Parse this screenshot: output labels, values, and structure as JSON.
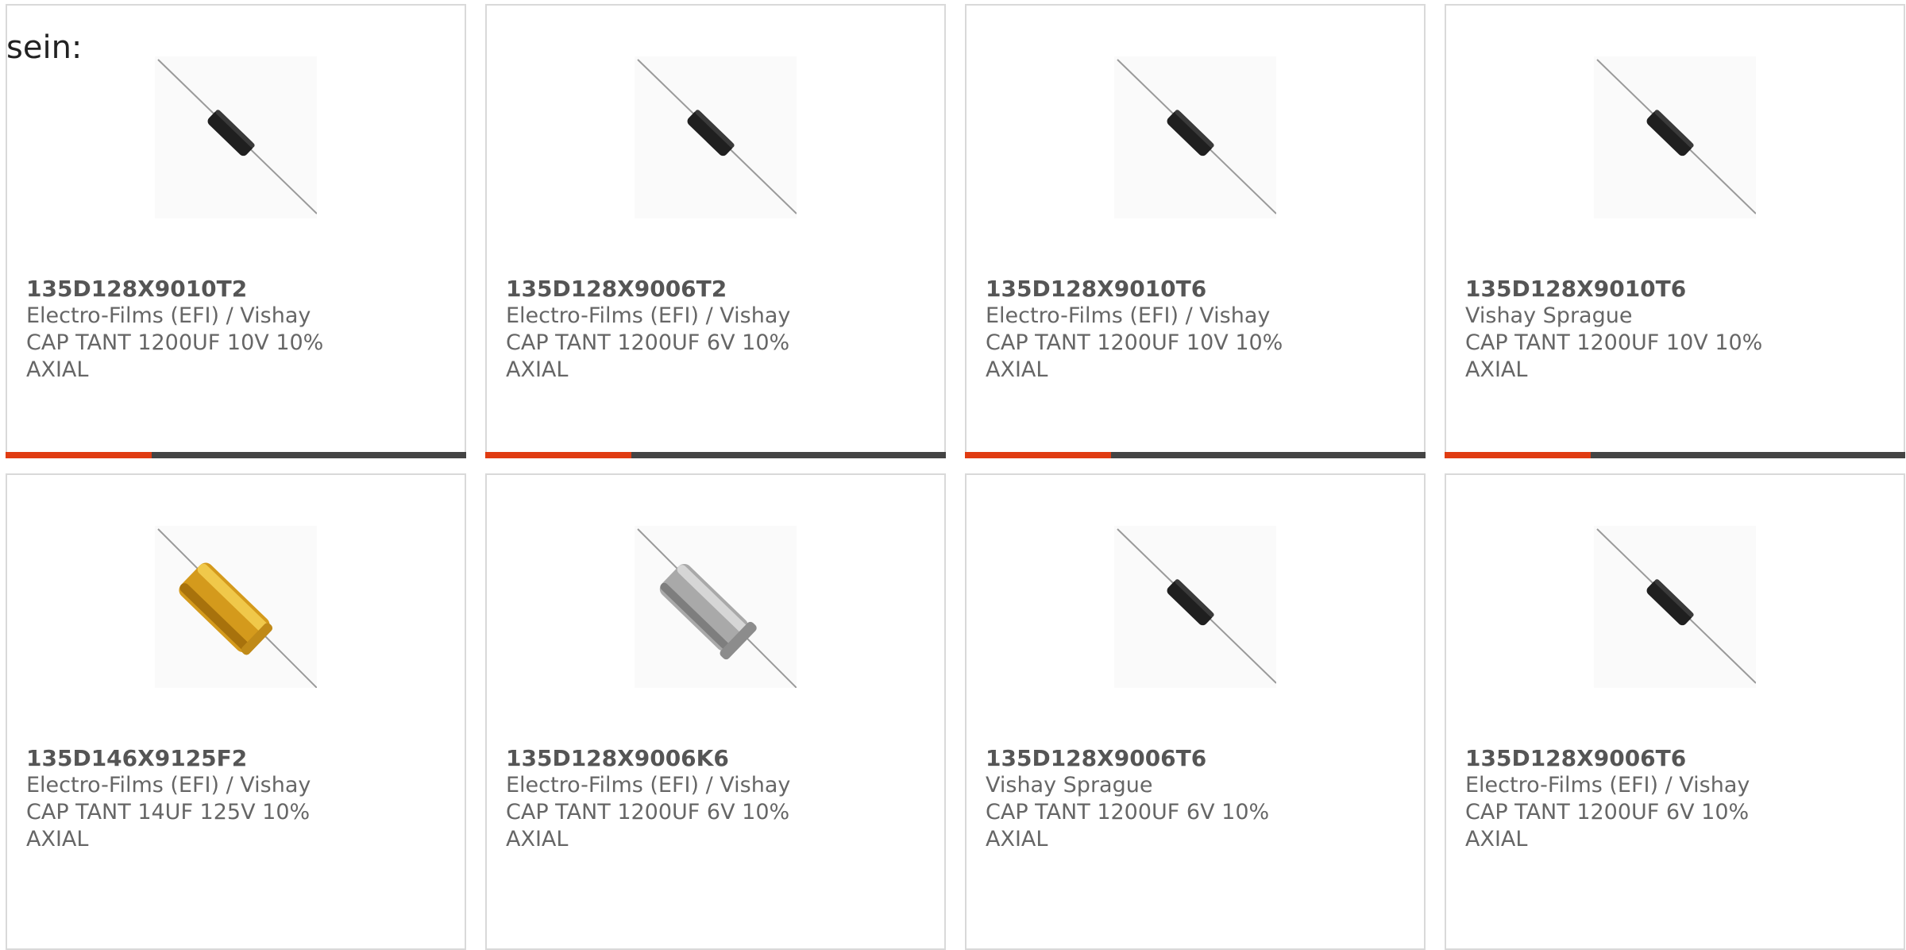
{
  "intro_text": "sein:",
  "colors": {
    "accent": "#e03c12",
    "bar": "#444444",
    "border": "#d9d9d9",
    "text": "#666666"
  },
  "products": [
    {
      "part_number": "135D128X9010T2",
      "manufacturer": "Electro-Films (EFI) / Vishay",
      "description": "CAP TANT 1200UF 10V 10% AXIAL",
      "image_icon": "black-axial-capacitor-icon"
    },
    {
      "part_number": "135D128X9006T2",
      "manufacturer": "Electro-Films (EFI) / Vishay",
      "description": "CAP TANT 1200UF 6V 10% AXIAL",
      "image_icon": "black-axial-capacitor-icon"
    },
    {
      "part_number": "135D128X9010T6",
      "manufacturer": "Electro-Films (EFI) / Vishay",
      "description": "CAP TANT 1200UF 10V 10% AXIAL",
      "image_icon": "black-axial-capacitor-icon"
    },
    {
      "part_number": "135D128X9010T6",
      "manufacturer": "Vishay Sprague",
      "description": "CAP TANT 1200UF 10V 10% AXIAL",
      "image_icon": "black-axial-capacitor-icon"
    },
    {
      "part_number": "135D146X9125F2",
      "manufacturer": "Electro-Films (EFI) / Vishay",
      "description": "CAP TANT 14UF 125V 10% AXIAL",
      "image_icon": "amber-axial-capacitor-icon"
    },
    {
      "part_number": "135D128X9006K6",
      "manufacturer": "Electro-Films (EFI) / Vishay",
      "description": "CAP TANT 1200UF 6V 10% AXIAL",
      "image_icon": "silver-axial-capacitor-icon"
    },
    {
      "part_number": "135D128X9006T6",
      "manufacturer": "Vishay Sprague",
      "description": "CAP TANT 1200UF 6V 10% AXIAL",
      "image_icon": "black-axial-capacitor-icon"
    },
    {
      "part_number": "135D128X9006T6",
      "manufacturer": "Electro-Films (EFI) / Vishay",
      "description": "CAP TANT 1200UF 6V 10% AXIAL",
      "image_icon": "black-axial-capacitor-icon"
    }
  ]
}
